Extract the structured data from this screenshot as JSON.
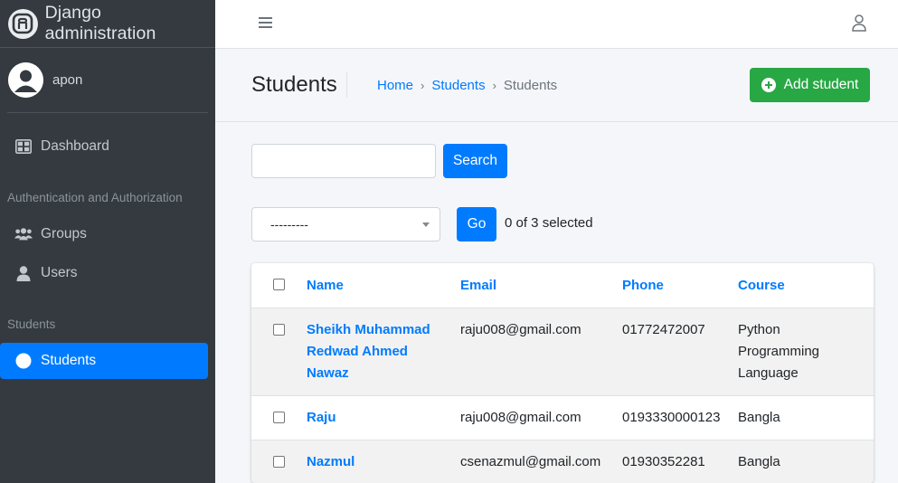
{
  "brand": {
    "title": "Django administration",
    "logo_icon": "django-logo-icon"
  },
  "user": {
    "name": "apon"
  },
  "sidebar": {
    "dashboard": "Dashboard",
    "section_auth": "Authentication and Authorization",
    "groups": "Groups",
    "users": "Users",
    "section_students": "Students",
    "students": "Students"
  },
  "header": {
    "title": "Students",
    "breadcrumb": [
      "Home",
      "Students",
      "Students"
    ],
    "add_button": "Add student"
  },
  "search": {
    "button": "Search",
    "value": ""
  },
  "actions": {
    "selected_option": "---------",
    "go_button": "Go",
    "selected_count": "0 of 3 selected"
  },
  "table": {
    "columns": [
      "Name",
      "Email",
      "Phone",
      "Course"
    ],
    "rows": [
      {
        "name_lines": [
          "Sheikh Muhammad",
          "Redwad Ahmed",
          "Nawaz"
        ],
        "email": "raju008@gmail.com",
        "phone": "01772472007",
        "course_lines": [
          "Python",
          "Programming",
          "Language"
        ]
      },
      {
        "name_lines": [
          "Raju"
        ],
        "email": "raju008@gmail.com",
        "phone": "0193330000123",
        "course_lines": [
          "Bangla"
        ]
      },
      {
        "name_lines": [
          "Nazmul"
        ],
        "email": "csenazmul@gmail.com",
        "phone": "01930352281",
        "course_lines": [
          "Bangla"
        ]
      }
    ]
  },
  "colors": {
    "sidebar_bg": "#343a40",
    "primary": "#007bff",
    "success": "#28a745"
  }
}
